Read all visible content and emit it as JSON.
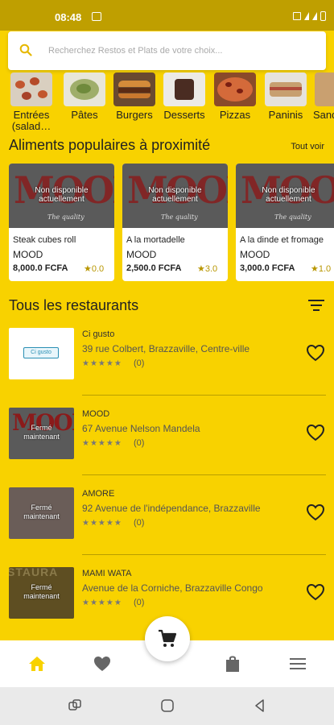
{
  "status_bar": {
    "time": "08:48"
  },
  "search": {
    "placeholder": "Recherchez Restos et Plats de votre choix..."
  },
  "categories": [
    {
      "label": "Entrées",
      "label2": "(salad…"
    },
    {
      "label": "Pâtes"
    },
    {
      "label": "Burgers"
    },
    {
      "label": "Desserts"
    },
    {
      "label": "Pizzas"
    },
    {
      "label": "Paninis"
    },
    {
      "label": "Sandwic"
    }
  ],
  "popular": {
    "title": "Aliments populaires à proximité",
    "see_all": "Tout voir",
    "items": [
      {
        "logo": "MOOD",
        "logo_sub": "The quality",
        "overlay_line1": "Non disponible",
        "overlay_line2": "actuellement",
        "name": "Steak cubes roll",
        "restaurant": "MOOD",
        "price": "8,000.0 FCFA",
        "rating": "★0.0"
      },
      {
        "logo": "MOOD",
        "logo_sub": "The quality",
        "overlay_line1": "Non disponible",
        "overlay_line2": "actuellement",
        "name": "A la mortadelle",
        "restaurant": "MOOD",
        "price": "2,500.0 FCFA",
        "rating": "★3.0"
      },
      {
        "logo": "MOOD",
        "logo_sub": "The quality",
        "overlay_line1": "Non disponible",
        "overlay_line2": "actuellement",
        "name": "A la dinde et fromage",
        "restaurant": "MOOD",
        "price": "3,000.0 FCFA",
        "rating": "★1.0"
      }
    ]
  },
  "restaurants": {
    "title": "Tous les restaurants",
    "items": [
      {
        "name": "Ci gusto",
        "thumb_text": "Ci gusto",
        "address": "39 rue Colbert, Brazzaville, Centre-ville",
        "stars": "★★★★★",
        "reviews": "(0)",
        "overlay_line1": "",
        "overlay_line2": ""
      },
      {
        "name": "MOOD",
        "thumb_text": "MOOD",
        "address": "67 Avenue Nelson Mandela",
        "stars": "★★★★★",
        "reviews": "(0)",
        "overlay_line1": "Fermé",
        "overlay_line2": "maintenant"
      },
      {
        "name": "AMORE",
        "thumb_text": "",
        "address": "92 Avenue de l'indépendance, Brazzaville",
        "stars": "★★★★★",
        "reviews": "(0)",
        "overlay_line1": "Fermé",
        "overlay_line2": "maintenant"
      },
      {
        "name": "MAMI WATA",
        "thumb_text": "STAURA",
        "address": "Avenue de la Corniche, Brazzaville Congo",
        "stars": "★★★★★",
        "reviews": "(0)",
        "overlay_line1": "Fermé",
        "overlay_line2": "maintenant"
      }
    ]
  },
  "colors": {
    "brand_yellow": "#f8d200",
    "status_bar": "#bf9f00",
    "nav_active": "#f8d200",
    "nav_inactive": "#666666"
  },
  "bottom_nav": [
    "home-icon",
    "heart-icon",
    "cart-icon",
    "bag-icon",
    "menu-icon"
  ],
  "system_nav": [
    "recent-apps-icon",
    "home-circle-icon",
    "back-icon"
  ]
}
